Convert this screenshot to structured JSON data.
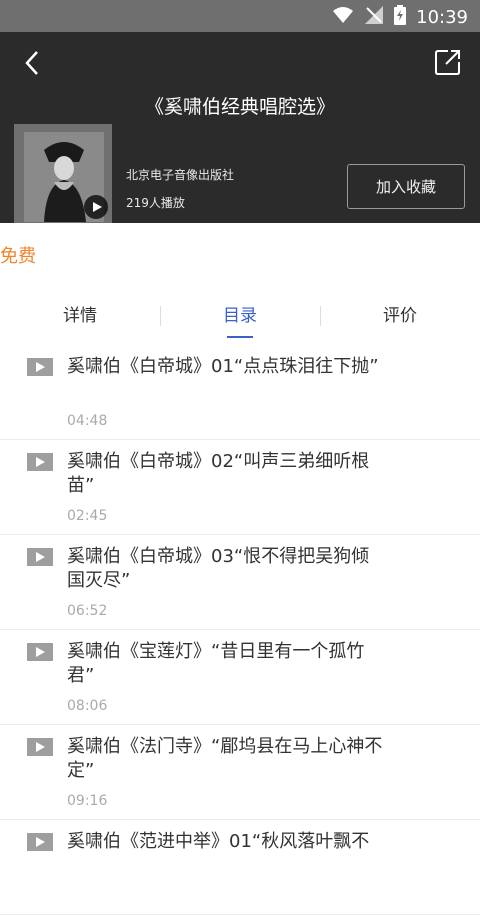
{
  "status": {
    "time": "10:39"
  },
  "album": {
    "title": "《奚啸伯经典唱腔选》",
    "publisher": "北京电子音像出版社",
    "plays": "219人播放",
    "favorite_label": "加入收藏"
  },
  "price_label": "免费",
  "tabs": [
    {
      "label": "详情"
    },
    {
      "label": "目录"
    },
    {
      "label": "评价"
    }
  ],
  "tracks": [
    {
      "title": "奚啸伯《白帝城》01“点点珠泪往下抛”",
      "duration": "04:48"
    },
    {
      "title": "奚啸伯《白帝城》02“叫声三弟细听根苗”",
      "duration": "02:45"
    },
    {
      "title": "奚啸伯《白帝城》03“恨不得把吴狗倾国灭尽”",
      "duration": "06:52"
    },
    {
      "title": "奚啸伯《宝莲灯》“昔日里有一个孤竹君”",
      "duration": "08:06"
    },
    {
      "title": "奚啸伯《法门寺》“郿坞县在马上心神不定”",
      "duration": "09:16"
    },
    {
      "title": "奚啸伯《范进中举》01“秋风落叶飘不",
      "duration": ""
    }
  ],
  "icons": {
    "back": "back-arrow-icon",
    "share": "share-icon",
    "play": "play-icon",
    "wifi": "wifi-icon",
    "signal": "signal-icon",
    "battery": "battery-icon"
  }
}
